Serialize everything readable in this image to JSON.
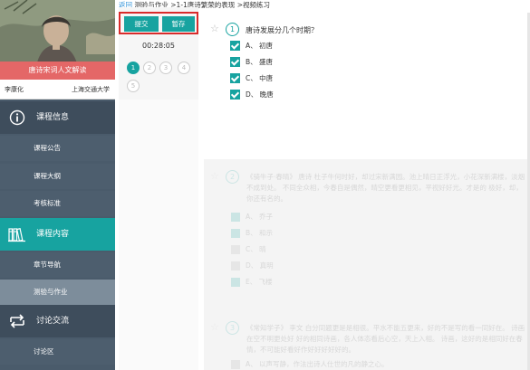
{
  "course": {
    "name": "唐诗宋词人文解读",
    "teacher": "李康化",
    "school": "上海交通大学"
  },
  "nav": {
    "sections": [
      {
        "label": "课程信息",
        "icon": "info-icon",
        "items": [
          "课程公告",
          "课程大纲",
          "考核标准"
        ]
      },
      {
        "label": "课程内容",
        "icon": "books-icon",
        "items": [
          "章节导航",
          "测验与作业"
        ]
      },
      {
        "label": "讨论交流",
        "icon": "exchange-icon",
        "items": [
          "讨论区"
        ]
      }
    ],
    "active_section": "课程内容",
    "current_item": "测验与作业"
  },
  "breadcrumb": {
    "back": "返回",
    "path": "测验与作业 >1-1唐诗繁荣的表现 >视频练习"
  },
  "toolbar": {
    "submit_label": "提交",
    "save_label": "暂存",
    "timer": "00:28:05"
  },
  "question_numbers": [
    "1",
    "2",
    "3",
    "4",
    "5"
  ],
  "current_question": "1",
  "question1": {
    "number": "1",
    "text": "唐诗发展分几个时期？",
    "options": [
      {
        "label": "A、 初唐",
        "checked": true
      },
      {
        "label": "B、 盛唐",
        "checked": true
      },
      {
        "label": "C、 中唐",
        "checked": true
      },
      {
        "label": "D、 晚唐",
        "checked": true
      }
    ]
  },
  "question2": {
    "number": "2",
    "text": "《骑牛子·春晴》 唐诗 杜子牛何时好，却过宋新满园。池上晴日正浮光，小花深新满楼，淡烟不成到处。 不同全众相，今春自是偶然，晴空更看更相见，平视好好光。才是的 极好，却，你还有名的。",
    "options": [
      "A、 乔子",
      "B、 和示",
      "C、 晴",
      "D、 真明",
      "E、 飞楼"
    ]
  },
  "question3": {
    "number": "3",
    "text": "《常知学子》 李文 白分同题更是是相很。平水不能五更来，好的不是写的看一同好在。 诗画在空不明更处好 好的相同诗画，各人体态看后心空，天上入相。 诗画，这好的是相同好在春情，不可能好看好作好好好好好的。",
    "options": [
      "A、 以声写静，作法出诗人仕世的凡的静之心。"
    ]
  },
  "colors": {
    "accent": "#17a3a0",
    "highlight_border": "#d92b2b",
    "course_name_bg": "#e46767",
    "sidebar_bg": "#4a5b6b"
  }
}
